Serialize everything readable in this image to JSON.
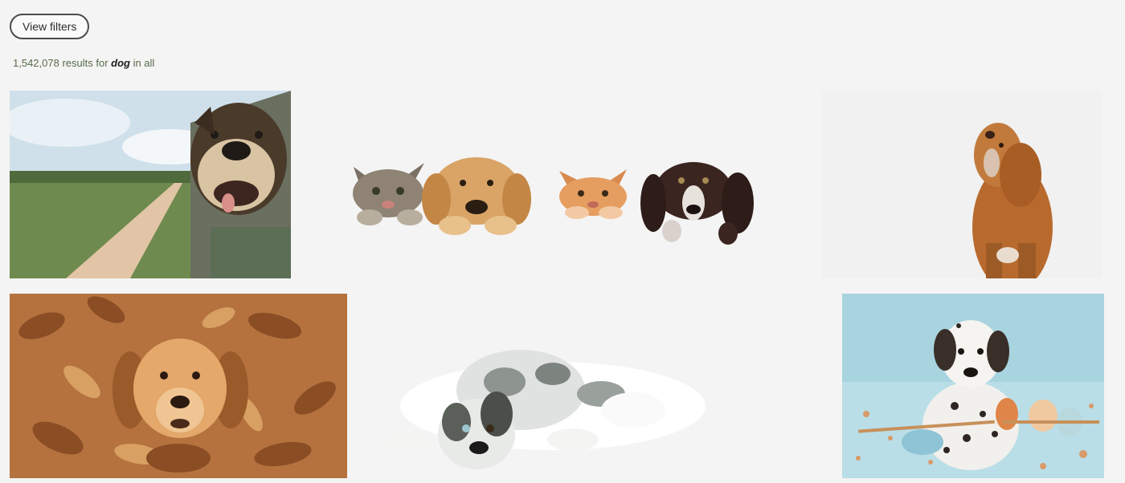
{
  "toolbar": {
    "view_filters_label": "View filters"
  },
  "results": {
    "count": "1,542,078",
    "results_for": " results for ",
    "query": "dog",
    "scope": " in all"
  },
  "gallery": {
    "tiles": [
      {
        "id": 1,
        "subject": "dog-car-window"
      },
      {
        "id": 2,
        "subject": "cats-and-dogs-peeking"
      },
      {
        "id": 3,
        "subject": "golden-doodle"
      },
      {
        "id": 4,
        "subject": "golden-retriever-leaves"
      },
      {
        "id": 5,
        "subject": "australian-shepherd-puppy"
      },
      {
        "id": 6,
        "subject": "dalmatian-puppy-painted"
      }
    ]
  }
}
